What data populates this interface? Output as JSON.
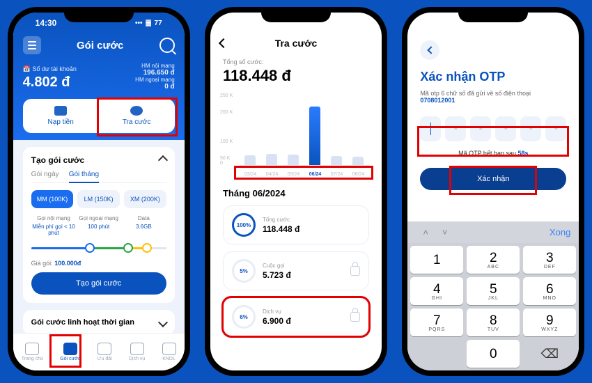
{
  "phone1": {
    "status_time": "14:30",
    "status_batt": "77",
    "title": "Gói cước",
    "balance_label": "Số dư tài khoản",
    "balance": "4.802 đ",
    "limit1_label": "HM nội mạng",
    "limit1": "196.650 đ",
    "limit2_label": "HM ngoại mạng",
    "limit2": "0 đ",
    "tab_left": "Nạp tiền",
    "tab_right": "Tra cước",
    "card1_title": "Tạo gói cước",
    "subtab_day": "Gói ngày",
    "subtab_month": "Gói tháng",
    "chips": [
      "MM (100K)",
      "LM (150K)",
      "XM (200K)"
    ],
    "feat": [
      {
        "t": "Gọi nội mạng",
        "v": "Miễn phí gọi < 10 phút"
      },
      {
        "t": "Gọi ngoại mạng",
        "v": "100 phút"
      },
      {
        "t": "Data",
        "v": "3.6GB"
      }
    ],
    "price_label": "Giá gói:",
    "price": "100.000đ",
    "create_btn": "Tạo gói cước",
    "card2_title": "Gói cước linh hoạt thời gian",
    "tabs": [
      "Trang chủ",
      "Gói cước",
      "Ưu đãi",
      "Dịch vụ",
      "KNDL"
    ]
  },
  "phone2": {
    "title": "Tra cước",
    "total_label": "Tổng số cước:",
    "total": "118.448 đ",
    "months": [
      "03/24",
      "04/24",
      "05/24",
      "06/24",
      "07/24",
      "08/24"
    ],
    "month_h": "Tháng 06/2024",
    "rows": [
      {
        "pct": "100%",
        "t": "Tổng cước",
        "v": "118.448 đ"
      },
      {
        "pct": "5%",
        "t": "Cuộc gọi",
        "v": "5.723 đ"
      },
      {
        "pct": "6%",
        "t": "Dịch vụ",
        "v": "6.900 đ"
      }
    ]
  },
  "chart_data": {
    "type": "bar",
    "categories": [
      "03/24",
      "04/24",
      "05/24",
      "06/24",
      "07/24",
      "08/24"
    ],
    "values": [
      30,
      35,
      32,
      200,
      28,
      26
    ],
    "ylabel": "K",
    "ylim": [
      0,
      250
    ],
    "yticks": [
      0,
      50,
      100,
      200,
      250
    ],
    "highlighted_index": 3
  },
  "phone3": {
    "title": "Xác nhận OTP",
    "sub_pre": "Mã otp 6 chữ số đã gửi về số điện thoại ",
    "phone": "0708012001",
    "expire_pre": "Mã OTP hết hạn sau ",
    "expire": "58s",
    "confirm": "Xác nhận",
    "kb_done": "Xong",
    "keys": [
      {
        "n": "1",
        "l": ""
      },
      {
        "n": "2",
        "l": "ABC"
      },
      {
        "n": "3",
        "l": "DEF"
      },
      {
        "n": "4",
        "l": "GHI"
      },
      {
        "n": "5",
        "l": "JKL"
      },
      {
        "n": "6",
        "l": "MNO"
      },
      {
        "n": "7",
        "l": "PQRS"
      },
      {
        "n": "8",
        "l": "TUV"
      },
      {
        "n": "9",
        "l": "WXYZ"
      },
      {
        "n": "",
        "l": ""
      },
      {
        "n": "0",
        "l": ""
      },
      {
        "n": "⌫",
        "l": ""
      }
    ]
  }
}
